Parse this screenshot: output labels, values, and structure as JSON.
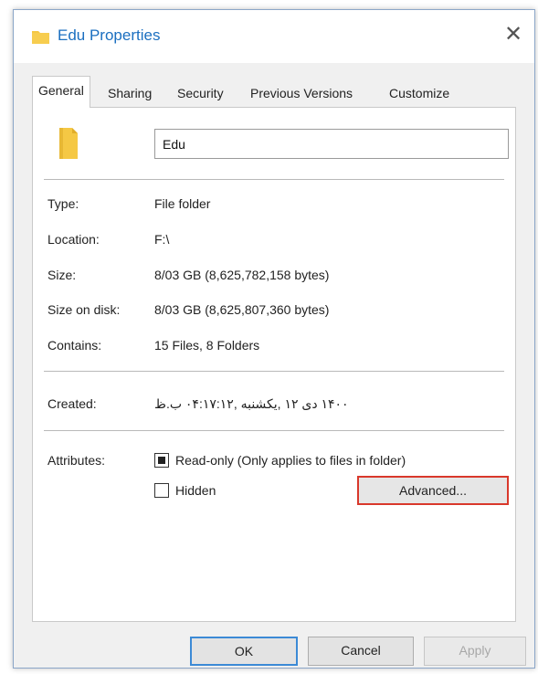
{
  "window": {
    "title": "Edu Properties",
    "close_glyph": "✕"
  },
  "tabs": [
    {
      "label": "General",
      "active": true
    },
    {
      "label": "Sharing"
    },
    {
      "label": "Security"
    },
    {
      "label": "Previous Versions"
    },
    {
      "label": "Customize"
    }
  ],
  "general": {
    "folder_name": "Edu",
    "properties": [
      {
        "label": "Type:",
        "value": "File folder"
      },
      {
        "label": "Location:",
        "value": "F:\\"
      },
      {
        "label": "Size:",
        "value": "8/03 GB (8,625,782,158 bytes)"
      },
      {
        "label": "Size on disk:",
        "value": "8/03 GB (8,625,807,360 bytes)"
      },
      {
        "label": "Contains:",
        "value": "15 Files, 8 Folders"
      }
    ],
    "created": {
      "label": "Created:",
      "value": "۱۴۰۰ دی ۱۲ ,یکشنبه ,۰۴:۱۷:۱۲ ب.ظ"
    },
    "attributes": {
      "label": "Attributes:",
      "readonly": {
        "label": "Read-only (Only applies to files in folder)",
        "state": "indeterminate"
      },
      "hidden": {
        "label": "Hidden",
        "state": "unchecked"
      },
      "advanced_label": "Advanced..."
    }
  },
  "buttons": {
    "ok": "OK",
    "cancel": "Cancel",
    "apply": "Apply"
  },
  "colors": {
    "accent": "#1b6fc0",
    "highlight": "#d9382b",
    "folder": "#f5c844"
  },
  "icons": [
    "folder-icon",
    "close-icon"
  ]
}
